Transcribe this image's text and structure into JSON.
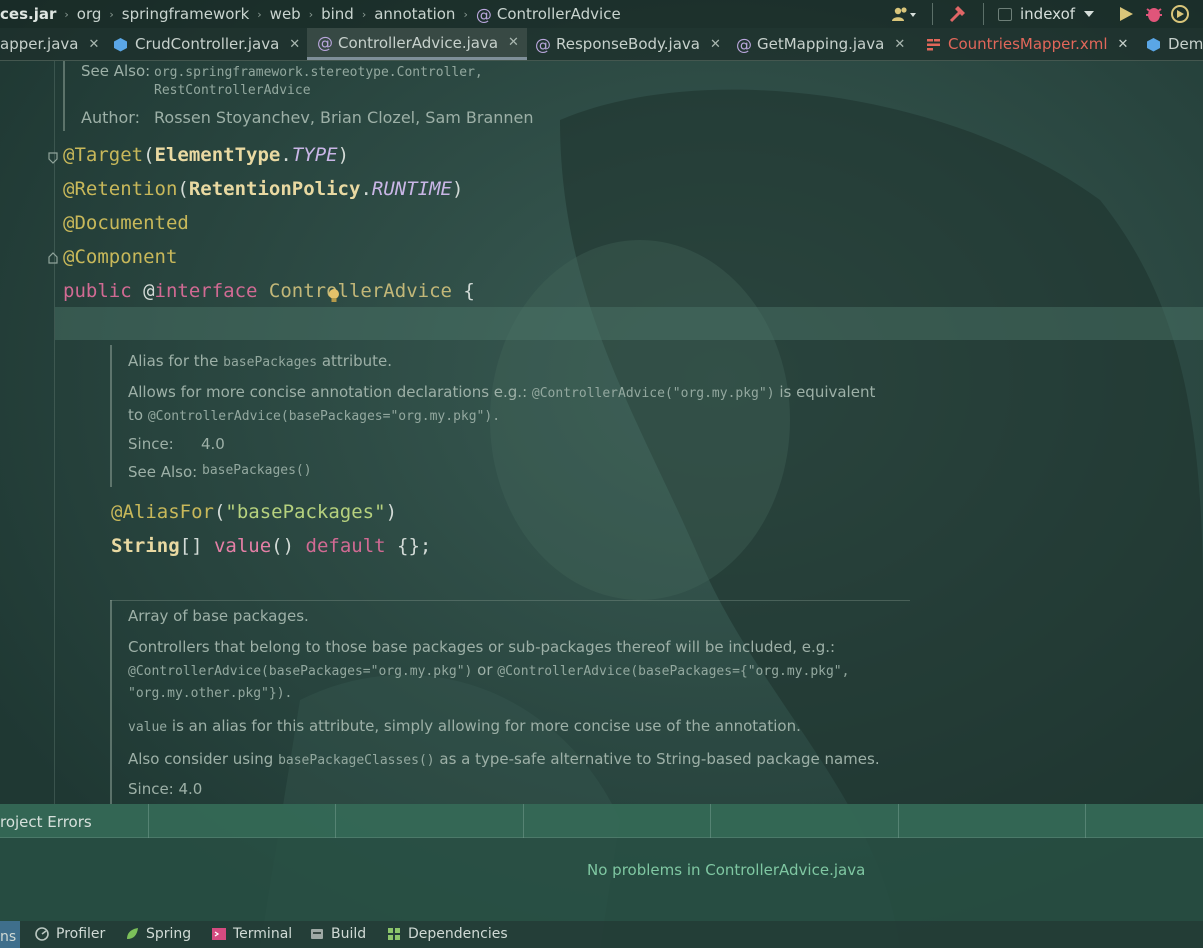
{
  "breadcrumb": {
    "items": [
      "ces.jar",
      "org",
      "springframework",
      "web",
      "bind",
      "annotation",
      "ControllerAdvice"
    ],
    "current_icon": "annotation-icon"
  },
  "toolbar": {
    "run_config": "indexof",
    "icons": [
      "users-icon",
      "hammer-icon",
      "run-icon",
      "debug-icon",
      "coverage-icon"
    ]
  },
  "tabs": [
    {
      "label": "apper.java",
      "active": false,
      "icon": "class-icon"
    },
    {
      "label": "CrudController.java",
      "active": false,
      "icon": "class-icon"
    },
    {
      "label": "ControllerAdvice.java",
      "active": true,
      "icon": "annotation-icon"
    },
    {
      "label": "ResponseBody.java",
      "active": false,
      "icon": "annotation-icon"
    },
    {
      "label": "GetMapping.java",
      "active": false,
      "icon": "annotation-icon"
    },
    {
      "label": "CountriesMapper.xml",
      "active": false,
      "icon": "xml-icon"
    },
    {
      "label": "Dem",
      "active": false,
      "icon": "class-icon"
    }
  ],
  "doc_top": {
    "see_also_label": "See Also:",
    "see_also_line1": "org.springframework.stereotype.Controller,",
    "see_also_line2": "RestControllerAdvice",
    "author_label": "Author:",
    "authors": "Rossen Stoyanchev, Brian Clozel, Sam Brannen"
  },
  "code": {
    "l1_ann": "@Target",
    "l1_open": "(",
    "l1_type": "ElementType",
    "l1_dot": ".",
    "l1_const": "TYPE",
    "l1_close": ")",
    "l2_ann": "@Retention",
    "l2_open": "(",
    "l2_type": "RetentionPolicy",
    "l2_dot": ".",
    "l2_const": "RUNTIME",
    "l2_close": ")",
    "l3_ann": "@Documented",
    "l4_ann": "@Component",
    "l5_public": "public ",
    "l5_at": "@",
    "l5_interface": "interface ",
    "l5_name": "ControllerAdvice",
    "l5_brace": " {",
    "l6_ann": "@AliasFor",
    "l6_open": "(",
    "l6_str": "\"basePackages\"",
    "l6_close": ")",
    "l7_type": "String",
    "l7_arr": "[] ",
    "l7_meth": "value",
    "l7_parens": "() ",
    "l7_default": "default",
    "l7_end": " {};"
  },
  "doc_value": {
    "line1_pre": "Alias for the ",
    "line1_code": "basePackages",
    "line1_post": " attribute.",
    "line2_pre": "Allows for more concise annotation declarations e.g.: ",
    "line2_code": "@ControllerAdvice(\"org.my.pkg\")",
    "line2_post": " is equivalent",
    "line3_pre": "to ",
    "line3_code": "@ControllerAdvice(basePackages=\"org.my.pkg\").",
    "since_label": "Since:",
    "since_value": "4.0",
    "see_also_label": "See Also:",
    "see_also_code": "basePackages()"
  },
  "doc_base": {
    "line1": "Array of base packages.",
    "line2": "Controllers that belong to those base packages or sub-packages thereof will be included, e.g.:",
    "line3_code1": "@ControllerAdvice(basePackages=\"org.my.pkg\")",
    "line3_or": " or ",
    "line3_code2": "@ControllerAdvice(basePackages={\"org.my.pkg\",",
    "line4_code": "\"org.my.other.pkg\"}).",
    "line5_code": "value",
    "line5_text": " is an alias for this attribute, simply allowing for more concise use of the annotation.",
    "line6_pre": "Also consider using ",
    "line6_code": "basePackageClasses()",
    "line6_post": " as a type-safe alternative to String-based package names.",
    "since": "Since: 4.0"
  },
  "problems": {
    "tab_label": "roject Errors",
    "message": "No problems in ControllerAdvice.java"
  },
  "tool_windows": [
    {
      "label": "ns",
      "icon": ""
    },
    {
      "label": "Profiler",
      "icon": "profiler-icon"
    },
    {
      "label": "Spring",
      "icon": "spring-icon"
    },
    {
      "label": "Terminal",
      "icon": "terminal-icon"
    },
    {
      "label": "Build",
      "icon": "build-icon"
    },
    {
      "label": "Dependencies",
      "icon": "dependencies-icon"
    }
  ]
}
